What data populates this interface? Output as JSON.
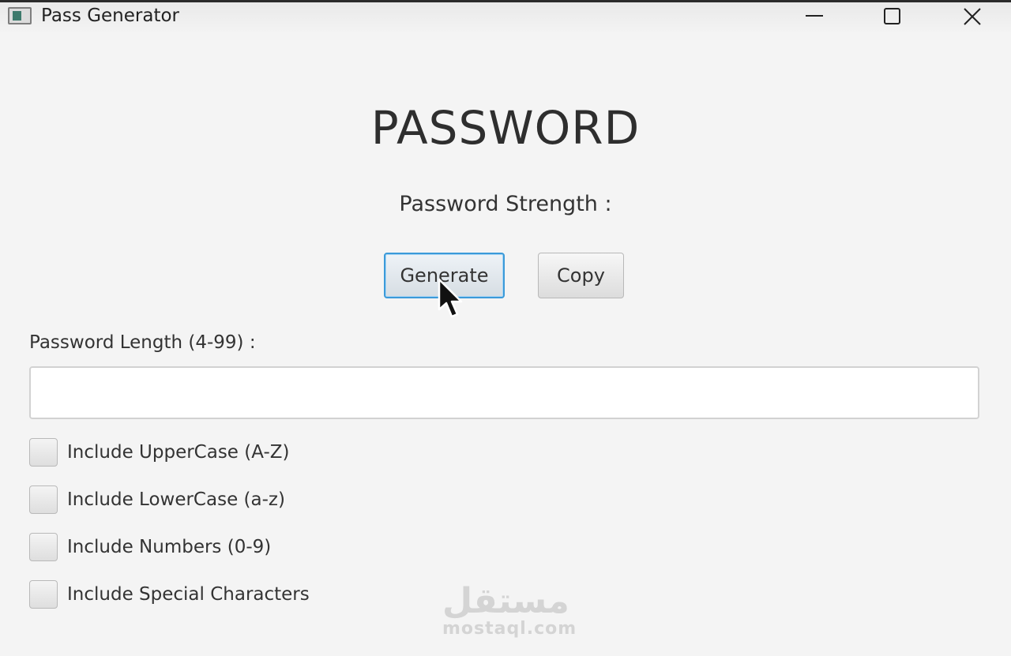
{
  "window": {
    "title": "Pass Generator"
  },
  "main": {
    "heading": "PASSWORD",
    "strength_label": "Password Strength :",
    "generate_label": "Generate",
    "copy_label": "Copy",
    "length_label": "Password Length (4-99) :",
    "length_value": "",
    "options": {
      "uppercase": {
        "label": "Include UpperCase (A-Z)",
        "checked": false
      },
      "lowercase": {
        "label": "Include LowerCase (a-z)",
        "checked": false
      },
      "numbers": {
        "label": "Include Numbers (0-9)",
        "checked": false
      },
      "special": {
        "label": "Include Special Characters",
        "checked": false
      }
    }
  },
  "watermark": {
    "logo": "مستقل",
    "url": "mostaql.com"
  },
  "colors": {
    "focus_border": "#3b9ad9",
    "background": "#f4f4f4"
  },
  "icons": {
    "app": "app-window-icon",
    "minimize": "minimize-icon",
    "maximize": "maximize-icon",
    "close": "close-icon",
    "cursor": "mouse-pointer-icon"
  }
}
